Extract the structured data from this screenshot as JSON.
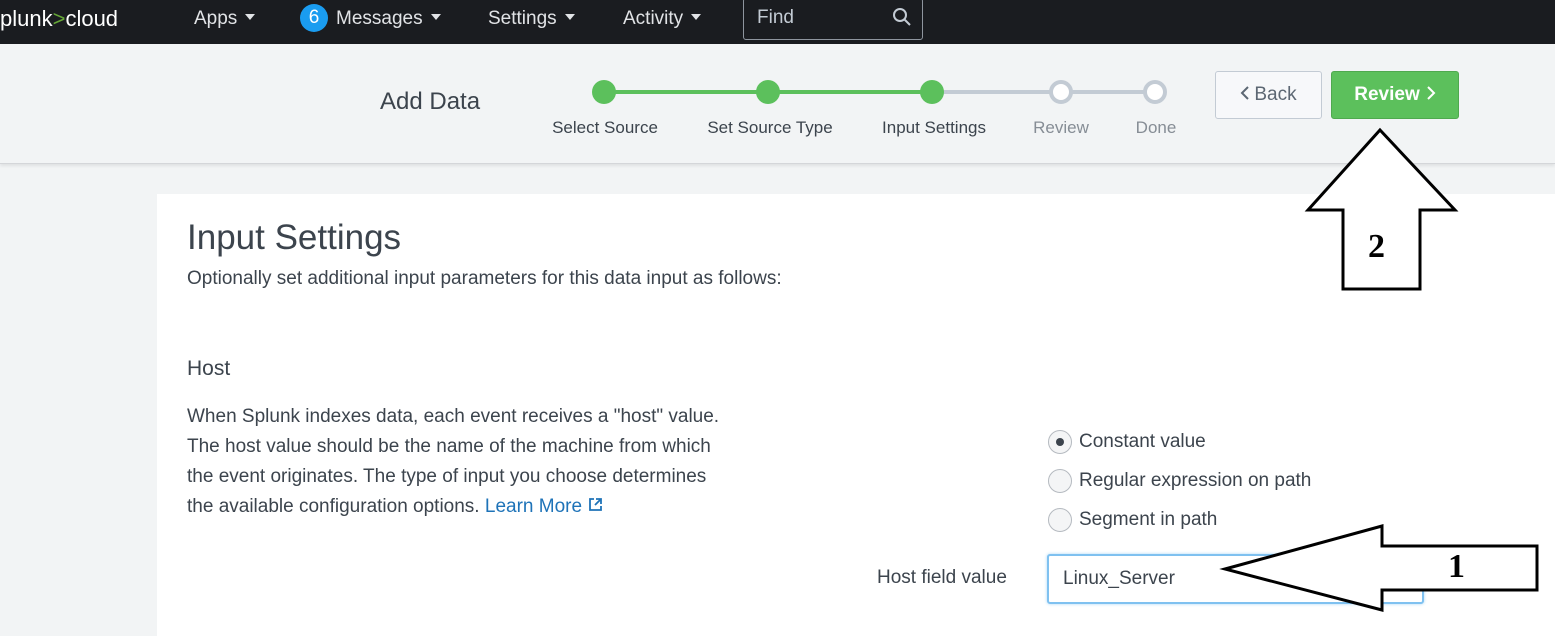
{
  "nav": {
    "logo_part1": "plunk",
    "logo_gt": ">",
    "logo_part2": "cloud",
    "apps": "Apps",
    "messages_count": "6",
    "messages": "Messages",
    "settings": "Settings",
    "activity": "Activity",
    "find_placeholder": "Find"
  },
  "header": {
    "title": "Add Data",
    "steps": [
      {
        "label": "Select Source",
        "state": "complete"
      },
      {
        "label": "Set Source Type",
        "state": "complete"
      },
      {
        "label": "Input Settings",
        "state": "current"
      },
      {
        "label": "Review",
        "state": "pending"
      },
      {
        "label": "Done",
        "state": "pending"
      }
    ],
    "back_label": "Back",
    "review_label": "Review"
  },
  "main": {
    "title": "Input Settings",
    "subtitle": "Optionally set additional input parameters for this data input as follows:",
    "section_title": "Host",
    "desc_lines": [
      "When Splunk indexes data, each event receives a \"host\" value.",
      "The host value should be the name of the machine from which",
      "the event originates. The type of input you choose determines",
      "the available configuration options."
    ],
    "learn_more": "Learn More",
    "radio_options": [
      {
        "label": "Constant value",
        "selected": true
      },
      {
        "label": "Regular expression on path",
        "selected": false
      },
      {
        "label": "Segment in path",
        "selected": false
      }
    ],
    "host_field_label": "Host field value",
    "host_field_value": "Linux_Server"
  },
  "annotations": {
    "arrow1_number": "1",
    "arrow2_number": "2"
  },
  "colors": {
    "nav_bg": "#1a1c20",
    "step_done": "#5cc05c",
    "review_button": "#5cc05c",
    "link": "#1e73b8",
    "badge": "#1a9cf0"
  }
}
